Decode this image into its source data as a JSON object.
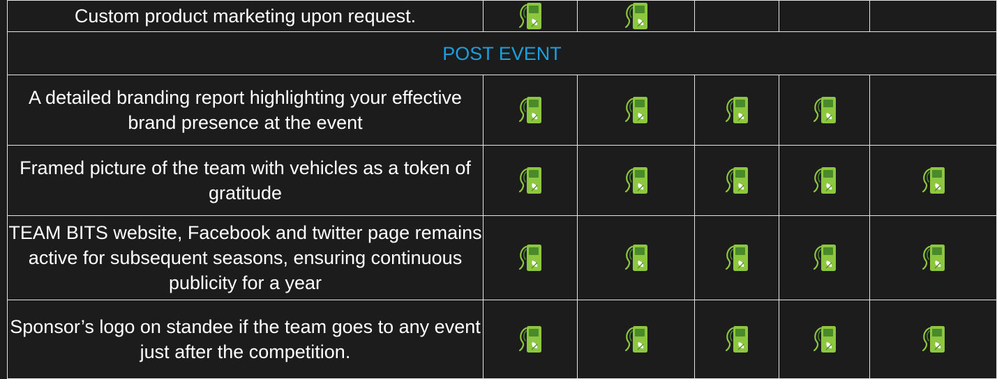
{
  "colors": {
    "background": "#1c1c1c",
    "border": "#e6e6e6",
    "text": "#ffffff",
    "section_header": "#1aa0e0",
    "icon_green": "#8dc63f",
    "icon_dark_green": "#4a8a2a"
  },
  "rows": [
    {
      "type": "benefit",
      "text": "Custom product marketing upon request.",
      "checks": [
        true,
        true,
        false,
        false,
        false
      ]
    },
    {
      "type": "section",
      "text": "POST EVENT"
    },
    {
      "type": "benefit",
      "text": "A detailed branding report highlighting your effective brand presence at the event",
      "checks": [
        true,
        true,
        true,
        true,
        false
      ]
    },
    {
      "type": "benefit",
      "text": "Framed picture of the team with vehicles as a token of gratitude",
      "checks": [
        true,
        true,
        true,
        true,
        true
      ]
    },
    {
      "type": "benefit",
      "text": "TEAM BITS website, Facebook and twitter page remains active for subsequent seasons, ensuring continuous publicity for a year",
      "checks": [
        true,
        true,
        true,
        true,
        true
      ]
    },
    {
      "type": "benefit",
      "text": "Sponsor’s logo on standee if the team goes to any event just after the competition.",
      "checks": [
        true,
        true,
        true,
        true,
        true
      ]
    }
  ],
  "check_icon": "eco-fuel-pump-icon"
}
